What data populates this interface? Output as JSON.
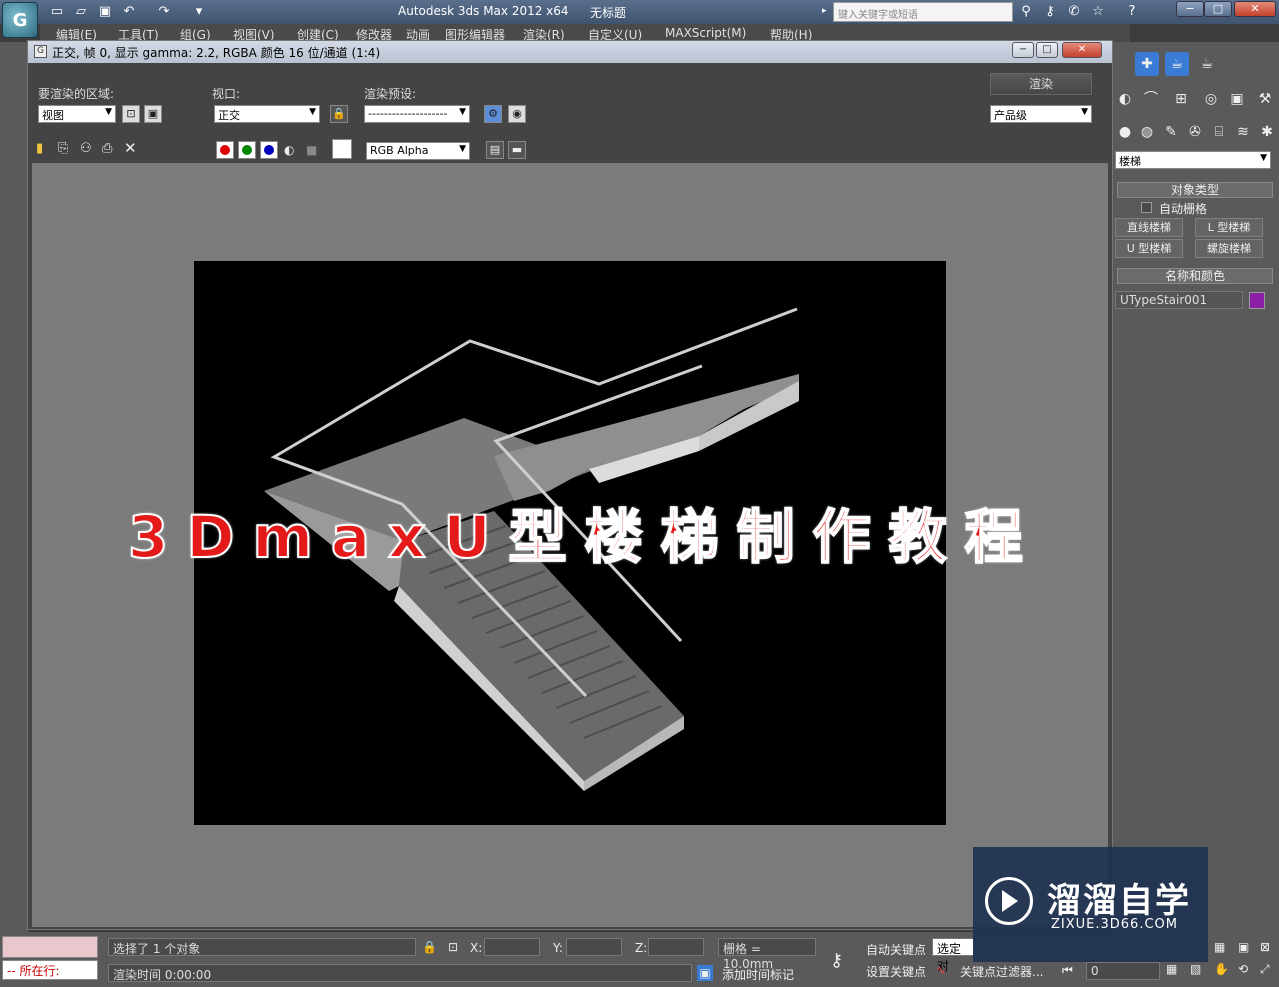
{
  "app": {
    "title": "Autodesk 3ds Max  2012 x64",
    "document": "无标题",
    "search_placeholder": "键入关键字或短语",
    "logo_glyph": "G"
  },
  "menu": [
    "编辑(E)",
    "工具(T)",
    "组(G)",
    "视图(V)",
    "创建(C)",
    "修改器",
    "动画",
    "图形编辑器",
    "渲染(R)",
    "自定义(U)",
    "MAXScript(M)",
    "帮助(H)"
  ],
  "render_window": {
    "title": "正交, 帧 0, 显示 gamma: 2.2, RGBA 颜色 16 位/通道 (1:4)",
    "area_label": "要渲染的区域:",
    "area_value": "视图",
    "viewport_label": "视口:",
    "viewport_value": "正交",
    "preset_label": "渲染预设:",
    "preset_value": "--------------------",
    "render_button": "渲染",
    "quality_value": "产品级",
    "channel_value": "RGB Alpha"
  },
  "overlay": {
    "title": "3DmaxU型楼梯制作教程",
    "color": "#e41a1a"
  },
  "command_panel": {
    "category": "楼梯",
    "object_type_header": "对象类型",
    "auto_grid": "自动栅格",
    "buttons": [
      "直线楼梯",
      "L 型楼梯",
      "U 型楼梯",
      "螺旋楼梯"
    ],
    "name_color_header": "名称和颜色",
    "object_name": "UTypeStair001",
    "object_color": "#8a1fa6"
  },
  "status": {
    "selection": "选择了 1 个对象",
    "render_time": "渲染时间 0:00:00",
    "mode": "所在行:",
    "x_label": "X:",
    "y_label": "Y:",
    "z_label": "Z:",
    "grid": "栅格 = 10.0mm",
    "add_time_tag": "添加时间标记",
    "auto_key": "自动关键点",
    "set_key": "设置关键点",
    "selected": "选定对",
    "key_filters": "关键点过滤器...",
    "frame": "0"
  },
  "watermark": {
    "name": "溜溜自学",
    "url": "ZIXUE.3D66.COM"
  }
}
